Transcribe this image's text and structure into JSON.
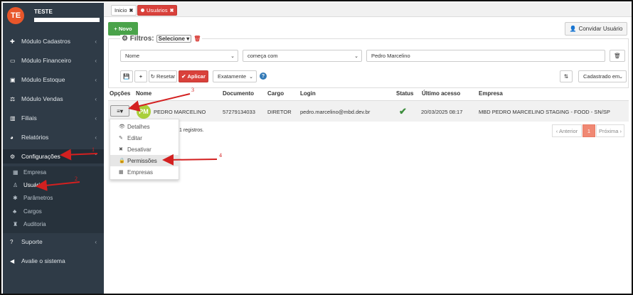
{
  "sidebar": {
    "avatar_initials": "TE",
    "user_name": "TESTE",
    "items": [
      {
        "label": "Módulo Cadastros",
        "icon": "plus-icon"
      },
      {
        "label": "Módulo Financeiro",
        "icon": "credit-card-icon"
      },
      {
        "label": "Módulo Estoque",
        "icon": "box-icon"
      },
      {
        "label": "Módulo Vendas",
        "icon": "balance-scale-icon"
      },
      {
        "label": "Filiais",
        "icon": "bar-chart-icon"
      },
      {
        "label": "Relatórios",
        "icon": "pie-chart-icon"
      },
      {
        "label": "Configurações",
        "icon": "cogs-icon"
      },
      {
        "label": "Suporte",
        "icon": "question-circle-icon"
      },
      {
        "label": "Avalie o sistema",
        "icon": "bullhorn-icon"
      }
    ],
    "sub_items": [
      {
        "label": "Empresa",
        "icon": "building-icon"
      },
      {
        "label": "Usuários",
        "icon": "user-icon"
      },
      {
        "label": "Parâmetros",
        "icon": "cog-icon"
      },
      {
        "label": "Cargos",
        "icon": "sitemap-icon"
      },
      {
        "label": "Auditoria",
        "icon": "audit-icon"
      }
    ]
  },
  "tabs": [
    {
      "label": "Inicio",
      "close": "✖"
    },
    {
      "label": "Usuários",
      "close": "✖"
    }
  ],
  "toolbar": {
    "novo_label": "+ Novo",
    "convidar_label": "Convidar Usuário"
  },
  "filters": {
    "title": "Filtros:",
    "select_label": "Selecione",
    "field": "Nome",
    "operator": "começa com",
    "value": "Pedro Marcelino",
    "reset_label": "Resetar",
    "apply_label": "Aplicar",
    "match_mode": "Exatamente",
    "sort_by": "Cadastrado em"
  },
  "table": {
    "headers": [
      "Opções",
      "Nome",
      "Documento",
      "Cargo",
      "Login",
      "Status",
      "Último acesso",
      "Empresa"
    ],
    "row": {
      "avatar_initials": "PM",
      "name": "PEDRO MARCELINO",
      "documento": "57279134033",
      "cargo": "DIRETOR",
      "login": "pedro.marcelino@mbd.dev.br",
      "status": "active",
      "ultimo_acesso": "20/03/2025 08:17",
      "empresa": "MBD PEDRO MARCELINO STAGING - FOOD - SN/SP"
    }
  },
  "records_info": "1 registros.",
  "pagination": {
    "prev": "‹ Anterior",
    "current": "1",
    "next": "Próxima ›"
  },
  "dropdown": [
    {
      "label": "Detalhes",
      "icon": "eye-icon"
    },
    {
      "label": "Editar",
      "icon": "pencil-icon"
    },
    {
      "label": "Desativar",
      "icon": "times-icon"
    },
    {
      "label": "Permissões",
      "icon": "lock-icon"
    },
    {
      "label": "Empresas",
      "icon": "building-icon"
    }
  ],
  "annotations": [
    "1",
    "2",
    "3",
    "4"
  ],
  "colors": {
    "sidebar_bg": "#2f3b47",
    "accent_red": "#d9413b",
    "success_green": "#4aa34a",
    "annotation_red": "#d32020"
  }
}
